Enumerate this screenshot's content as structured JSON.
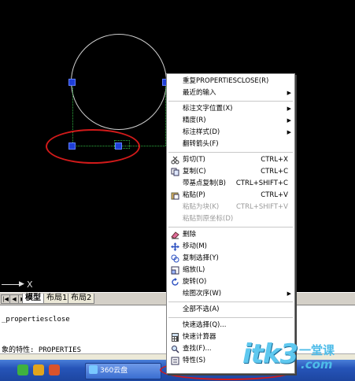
{
  "colors": {
    "menu_bg": "#ffffff",
    "grip": "#1f3fd6",
    "annotation_red": "#d21a1a",
    "taskbar": "#2654b8"
  },
  "ucs": {
    "x_label": "X"
  },
  "layout_tabs": {
    "nav": [
      "|◀",
      "◀",
      "▶",
      "▶|"
    ],
    "items": [
      "模型",
      "布局1",
      "布局2"
    ],
    "active": "模型"
  },
  "command_line": {
    "line1": "_propertiesclose",
    "line2": "象的特性:  PROPERTIES"
  },
  "taskbar": {
    "item_label": "360云盘"
  },
  "context_menu": {
    "items": [
      {
        "label": "重复PROPERTIESCLOSE(R)",
        "icon": "",
        "shortcut": "",
        "submenu": false,
        "disabled": false
      },
      {
        "label": "最近的输入",
        "icon": "",
        "shortcut": "",
        "submenu": true,
        "disabled": false
      },
      {
        "label": "标注文字位置(X)",
        "icon": "",
        "shortcut": "",
        "submenu": true,
        "disabled": false
      },
      {
        "label": "精度(R)",
        "icon": "",
        "shortcut": "",
        "submenu": true,
        "disabled": false
      },
      {
        "label": "标注样式(D)",
        "icon": "",
        "shortcut": "",
        "submenu": true,
        "disabled": false
      },
      {
        "label": "翻转箭头(F)",
        "icon": "",
        "shortcut": "",
        "submenu": false,
        "disabled": false
      },
      {
        "label": "剪切(T)",
        "icon": "scissors-icon",
        "shortcut": "CTRL+X",
        "submenu": false,
        "disabled": false
      },
      {
        "label": "复制(C)",
        "icon": "copy-icon",
        "shortcut": "CTRL+C",
        "submenu": false,
        "disabled": false
      },
      {
        "label": "带基点复制(B)",
        "icon": "",
        "shortcut": "CTRL+SHIFT+C",
        "submenu": false,
        "disabled": false
      },
      {
        "label": "粘贴(P)",
        "icon": "paste-icon",
        "shortcut": "CTRL+V",
        "submenu": false,
        "disabled": false
      },
      {
        "label": "粘贴为块(K)",
        "icon": "",
        "shortcut": "CTRL+SHIFT+V",
        "submenu": false,
        "disabled": true
      },
      {
        "label": "粘贴到原坐标(D)",
        "icon": "",
        "shortcut": "",
        "submenu": false,
        "disabled": true
      },
      {
        "label": "删除",
        "icon": "eraser-icon",
        "shortcut": "",
        "submenu": false,
        "disabled": false
      },
      {
        "label": "移动(M)",
        "icon": "move-icon",
        "shortcut": "",
        "submenu": false,
        "disabled": false
      },
      {
        "label": "复制选择(Y)",
        "icon": "copy-selection-icon",
        "shortcut": "",
        "submenu": false,
        "disabled": false
      },
      {
        "label": "缩放(L)",
        "icon": "scale-icon",
        "shortcut": "",
        "submenu": false,
        "disabled": false
      },
      {
        "label": "旋转(O)",
        "icon": "rotate-icon",
        "shortcut": "",
        "submenu": false,
        "disabled": false
      },
      {
        "label": "绘图次序(W)",
        "icon": "",
        "shortcut": "",
        "submenu": true,
        "disabled": false
      },
      {
        "label": "全部不选(A)",
        "icon": "",
        "shortcut": "",
        "submenu": false,
        "disabled": false
      },
      {
        "label": "快速选择(Q)...",
        "icon": "",
        "shortcut": "",
        "submenu": false,
        "disabled": false
      },
      {
        "label": "快速计算器",
        "icon": "calculator-icon",
        "shortcut": "",
        "submenu": false,
        "disabled": false
      },
      {
        "label": "查找(F)...",
        "icon": "find-icon",
        "shortcut": "",
        "submenu": false,
        "disabled": false
      },
      {
        "label": "特性(S)",
        "icon": "properties-icon",
        "shortcut": "",
        "submenu": false,
        "disabled": false
      }
    ]
  },
  "watermark": {
    "main": "itk3",
    "cn": "一堂课",
    "com": ".com"
  }
}
